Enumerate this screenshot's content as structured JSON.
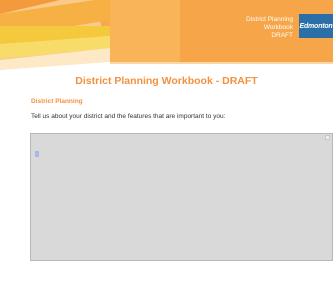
{
  "banner": {
    "line1": "District Planning",
    "line2": "Workbook",
    "line3": "DRAFT",
    "logo": "Edmonton"
  },
  "page": {
    "title": "District Planning Workbook - DRAFT",
    "section_heading": "District Planning",
    "prompt": "Tell us about your district and the features that are important to you:"
  },
  "textarea": {
    "value": ""
  },
  "colors": {
    "accent_orange": "#f2913f",
    "banner_orange": "#f7a94c",
    "banner_yellow": "#f5c93d",
    "logo_blue": "#2a6fa8",
    "textarea_bg": "#d9d9d9"
  }
}
